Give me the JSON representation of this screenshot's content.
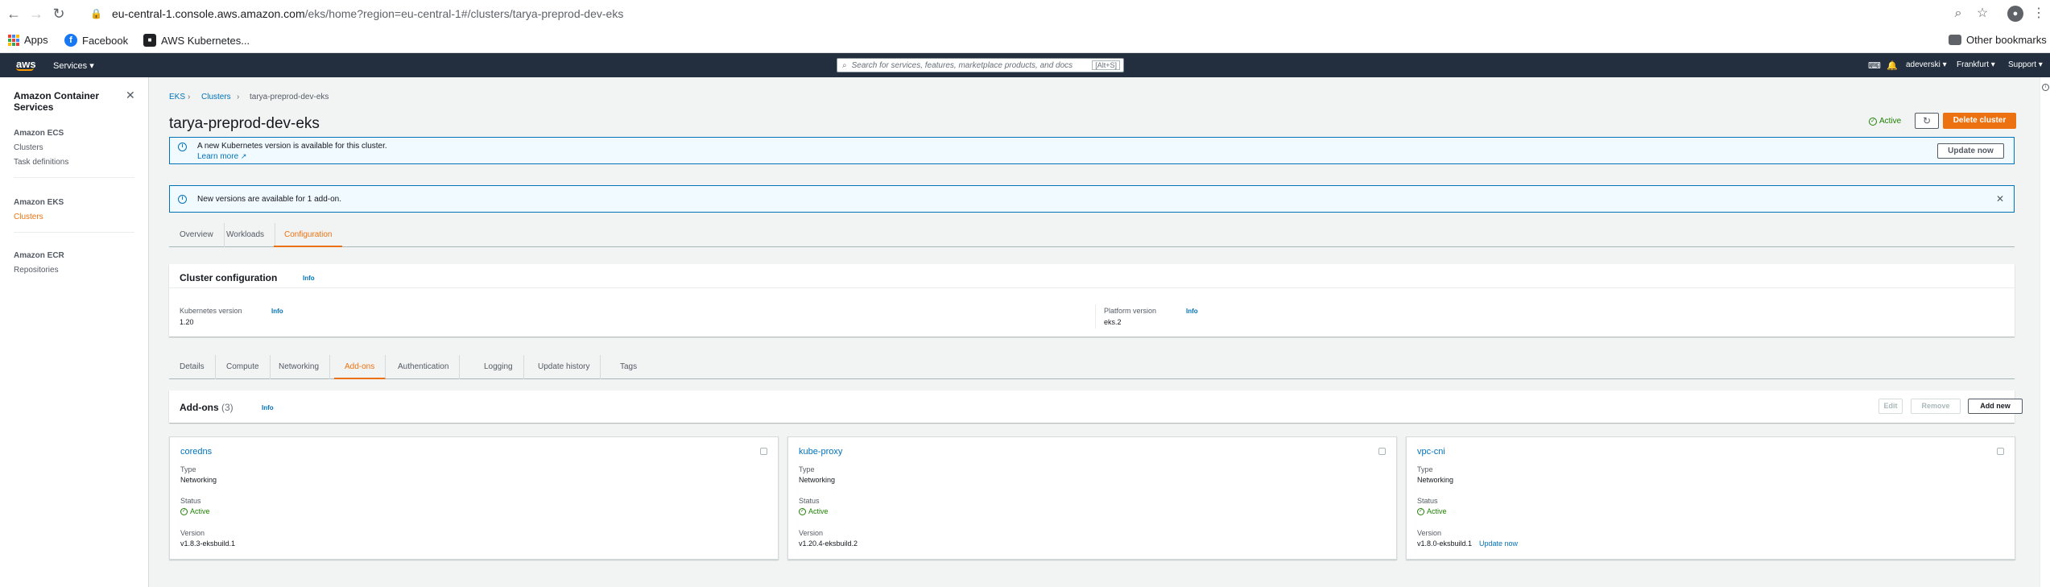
{
  "browser": {
    "url_host": "eu-central-1.console.aws.amazon.com",
    "url_path": "/eks/home?region=eu-central-1#/clusters/tarya-preprod-dev-eks",
    "bookmarks": [
      "Apps",
      "Facebook",
      "AWS Kubernetes..."
    ],
    "other_bookmarks": "Other bookmarks"
  },
  "aws_nav": {
    "logo": "aws",
    "services": "Services ▾",
    "search_placeholder": "Search for services, features, marketplace products, and docs",
    "search_shortcut": "[Alt+S]",
    "user": "adeverski ▾",
    "region": "Frankfurt ▾",
    "support": "Support ▾"
  },
  "sidebar": {
    "title": "Amazon Container Services",
    "sections": [
      {
        "title": "Amazon ECS",
        "items": [
          "Clusters",
          "Task definitions"
        ]
      },
      {
        "title": "Amazon EKS",
        "items": [
          "Clusters"
        ]
      },
      {
        "title": "Amazon ECR",
        "items": [
          "Repositories"
        ]
      }
    ]
  },
  "breadcrumb": [
    "EKS",
    "Clusters",
    "tarya-preprod-dev-eks"
  ],
  "page": {
    "title": "tarya-preprod-dev-eks",
    "status": "Active",
    "delete_label": "Delete cluster"
  },
  "flash1": {
    "message": "A new Kubernetes version is available for this cluster.",
    "link": "Learn more",
    "button": "Update now"
  },
  "flash2": {
    "message": "New versions are available for 1 add-on."
  },
  "main_tabs": [
    "Overview",
    "Workloads",
    "Configuration"
  ],
  "cluster_config": {
    "title": "Cluster configuration",
    "info": "Info",
    "k8s_label": "Kubernetes version",
    "k8s_value": "1.20",
    "platform_label": "Platform version",
    "platform_value": "eks.2"
  },
  "sub_tabs": [
    "Details",
    "Compute",
    "Networking",
    "Add-ons",
    "Authentication",
    "Logging",
    "Update history",
    "Tags"
  ],
  "addons": {
    "title": "Add-ons",
    "count": "(3)",
    "info": "Info",
    "edit": "Edit",
    "remove": "Remove",
    "add_new": "Add new",
    "type_label": "Type",
    "status_label": "Status",
    "version_label": "Version",
    "items": [
      {
        "name": "coredns",
        "type": "Networking",
        "status": "Active",
        "version": "v1.8.3-eksbuild.1",
        "update": ""
      },
      {
        "name": "kube-proxy",
        "type": "Networking",
        "status": "Active",
        "version": "v1.20.4-eksbuild.2",
        "update": ""
      },
      {
        "name": "vpc-cni",
        "type": "Networking",
        "status": "Active",
        "version": "v1.8.0-eksbuild.1",
        "update": "Update now"
      }
    ]
  }
}
